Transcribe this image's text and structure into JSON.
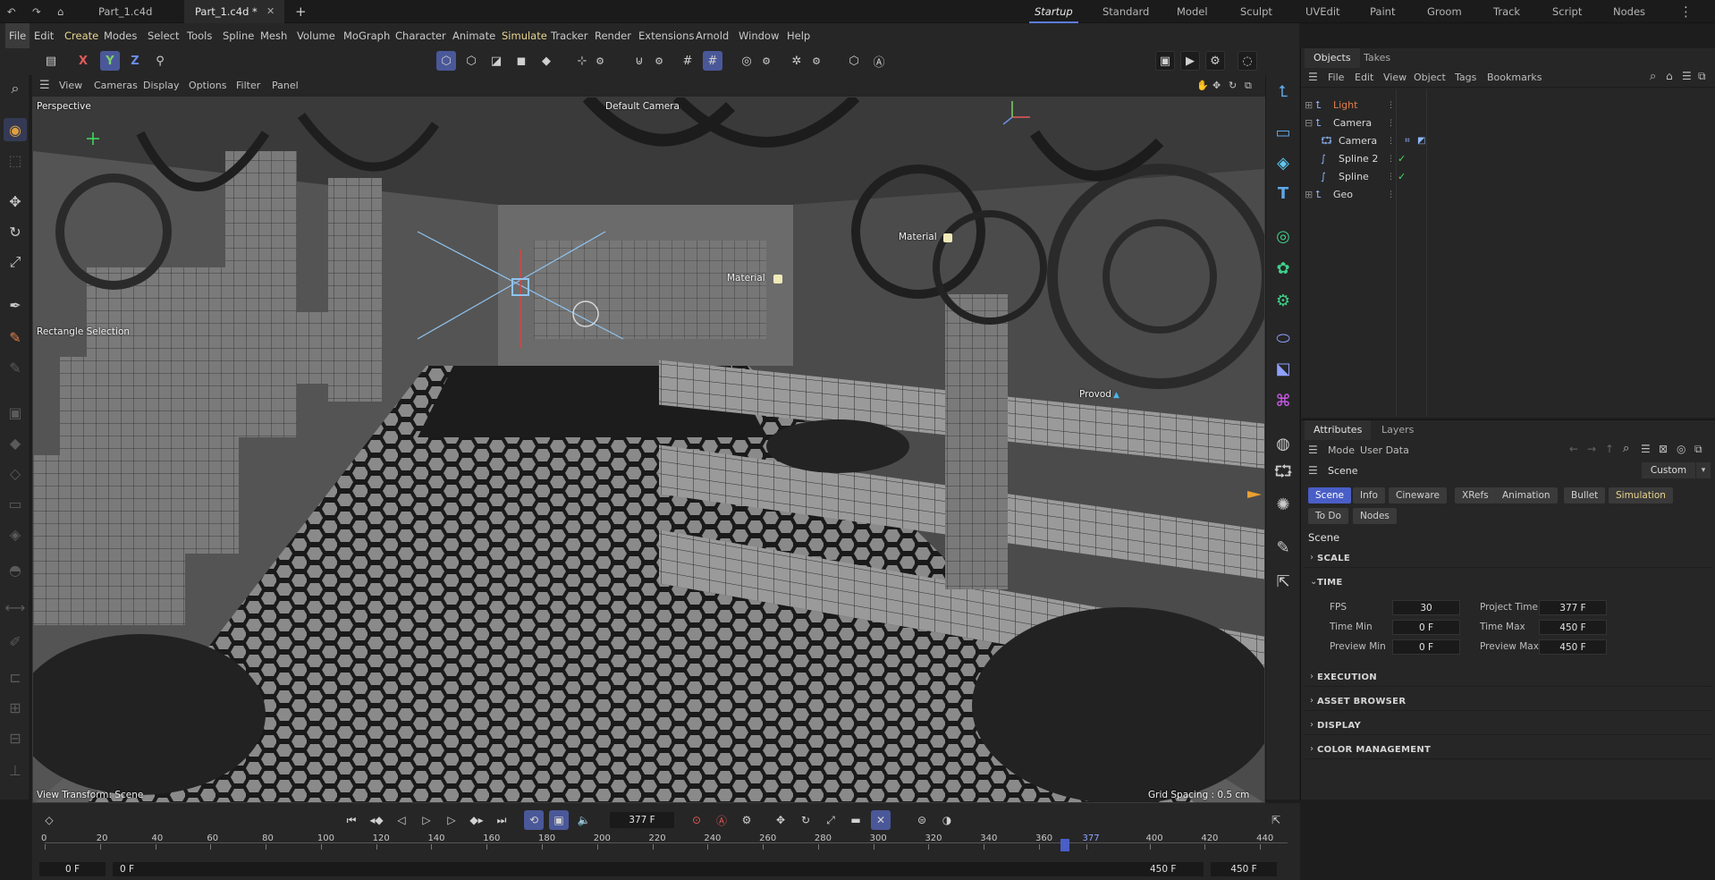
{
  "titlebar": {
    "tabs": [
      "Part_1.c4d",
      "Part_1.c4d *"
    ],
    "layouts": [
      "Startup",
      "Standard",
      "Model",
      "Sculpt",
      "UVEdit",
      "Paint",
      "Groom",
      "Track",
      "Script",
      "Nodes"
    ],
    "active_layout": "Startup"
  },
  "menubar": [
    "File",
    "Edit",
    "Create",
    "Modes",
    "Select",
    "Tools",
    "Spline",
    "Mesh",
    "Volume",
    "MoGraph",
    "Character",
    "Animate",
    "Simulate",
    "Tracker",
    "Render",
    "Extensions",
    "Arnold",
    "Window",
    "Help"
  ],
  "toolbar": {
    "axis_x": "X",
    "axis_y": "Y",
    "axis_z": "Z"
  },
  "viewport": {
    "menu": [
      "View",
      "Cameras",
      "Display",
      "Options",
      "Filter",
      "Panel"
    ],
    "view_name": "Perspective",
    "camera_name": "Default Camera",
    "labels": {
      "material_a": "Material",
      "material_b": "Material",
      "rect_selection": "Rectangle Selection",
      "provod": "Provod"
    },
    "view_transform": "View Transform: Scene",
    "grid_spacing": "Grid Spacing : 0.5 cm"
  },
  "objects_panel": {
    "tabs": [
      "Objects",
      "Takes"
    ],
    "menu": [
      "File",
      "Edit",
      "View",
      "Object",
      "Tags",
      "Bookmarks"
    ],
    "rows": [
      {
        "name": "Light",
        "indent": 0,
        "color": "#e07f4a"
      },
      {
        "name": "Camera",
        "indent": 0,
        "color": "#d8d8d8"
      },
      {
        "name": "Camera",
        "indent": 1,
        "color": "#d8d8d8"
      },
      {
        "name": "Spline 2",
        "indent": 1,
        "color": "#d8d8d8"
      },
      {
        "name": "Spline",
        "indent": 1,
        "color": "#d8d8d8"
      },
      {
        "name": "Geo",
        "indent": 0,
        "color": "#d8d8d8"
      }
    ]
  },
  "attributes": {
    "tabs": [
      "Attributes",
      "Layers"
    ],
    "menu": [
      "Mode",
      "User Data"
    ],
    "object": "Scene",
    "preset": "Custom",
    "chips_row1": [
      "Scene",
      "Info",
      "Cineware",
      "XRefs",
      "Animation",
      "Bullet",
      "Simulation"
    ],
    "chips_row2": [
      "To Do",
      "Nodes"
    ],
    "section": "Scene",
    "groups_top": [
      "SCALE",
      "TIME"
    ],
    "time_fields": {
      "fps_label": "FPS",
      "fps": "30",
      "project_time_label": "Project Time",
      "project_time": "377 F",
      "time_min_label": "Time Min",
      "time_min": "0 F",
      "time_max_label": "Time Max",
      "time_max": "450 F",
      "preview_min_label": "Preview Min",
      "preview_min": "0 F",
      "preview_max_label": "Preview Max",
      "preview_max": "450 F"
    },
    "groups_bottom": [
      "EXECUTION",
      "ASSET BROWSER",
      "DISPLAY",
      "COLOR MANAGEMENT"
    ]
  },
  "timeline": {
    "current_frame": "377 F",
    "ticks": [
      "0",
      "20",
      "40",
      "60",
      "80",
      "100",
      "120",
      "140",
      "160",
      "180",
      "200",
      "220",
      "240",
      "260",
      "280",
      "300",
      "320",
      "340",
      "360",
      "377",
      "400",
      "420",
      "440"
    ],
    "range_start_a": "0 F",
    "range_start_b": "0 F",
    "range_end_a": "450 F",
    "range_end_b": "450 F"
  },
  "colors": {
    "accent_blue": "#4a5ec7",
    "accent_yellow": "#e9d58e",
    "light_orange": "#e07f4a"
  }
}
